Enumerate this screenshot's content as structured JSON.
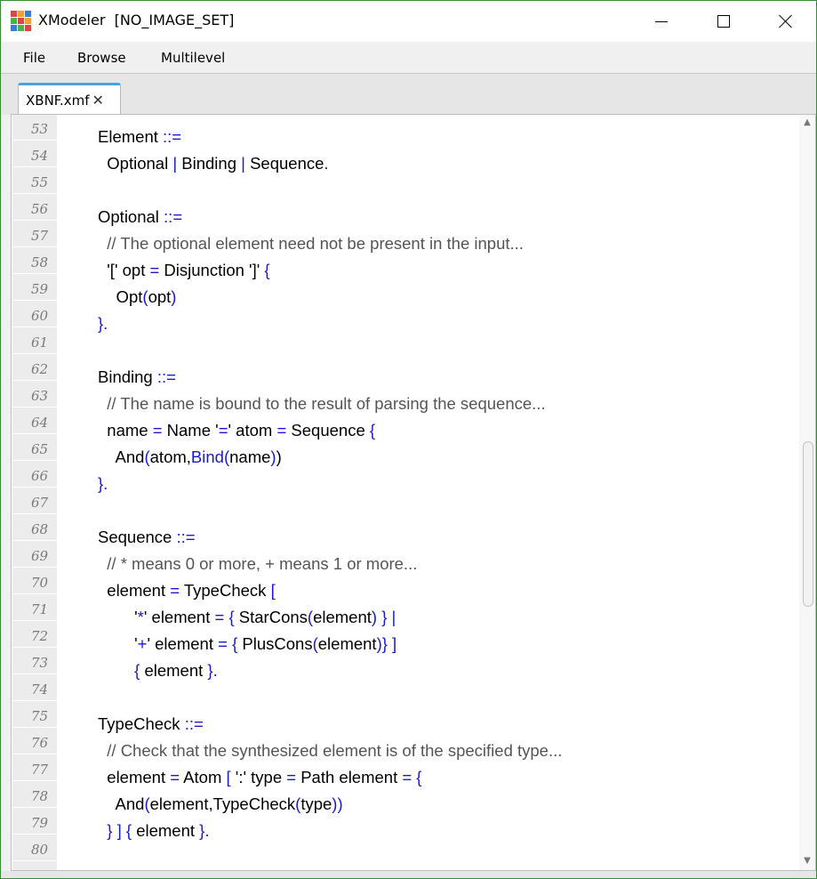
{
  "window": {
    "title": "XModeler  [NO_IMAGE_SET]",
    "icon_name": "xmodeler-app-icon",
    "icon_colors": [
      "#e04343",
      "#f2a12a",
      "#3a7bd5",
      "#4caf50",
      "#e04343",
      "#f2a12a",
      "#3a7bd5",
      "#4caf50",
      "#e04343"
    ],
    "buttons": {
      "minimize": "minimize-icon",
      "maximize": "maximize-icon",
      "close": "close-icon"
    }
  },
  "menu": {
    "items": [
      "File",
      "Browse",
      "Multilevel"
    ]
  },
  "tabs": [
    {
      "label": "XBNF.xmf",
      "close": "✕",
      "active": true
    }
  ],
  "editor": {
    "lines": [
      {
        "n": "53",
        "parts": [
          [
            "",
            "Element "
          ],
          [
            "kw",
            "::="
          ]
        ]
      },
      {
        "n": "54",
        "parts": [
          [
            "",
            "  Optional "
          ],
          [
            "kw",
            "|"
          ],
          [
            "",
            " Binding "
          ],
          [
            "kw",
            "|"
          ],
          [
            "",
            " Sequence"
          ],
          [
            "kw",
            "."
          ]
        ]
      },
      {
        "n": "55",
        "parts": []
      },
      {
        "n": "56",
        "parts": [
          [
            "",
            "Optional "
          ],
          [
            "kw",
            "::="
          ]
        ]
      },
      {
        "n": "57",
        "parts": [
          [
            "cm",
            "  // The optional element need not be present in the input..."
          ]
        ]
      },
      {
        "n": "58",
        "parts": [
          [
            "",
            "  '[' opt "
          ],
          [
            "kw",
            "="
          ],
          [
            "",
            " Disjunction ']' "
          ],
          [
            "kw",
            "{"
          ]
        ]
      },
      {
        "n": "59",
        "parts": [
          [
            "",
            "    Opt"
          ],
          [
            "kw",
            "("
          ],
          [
            "",
            "opt"
          ],
          [
            "kw",
            ")"
          ]
        ]
      },
      {
        "n": "60",
        "parts": [
          [
            "kw",
            "}."
          ]
        ]
      },
      {
        "n": "61",
        "parts": []
      },
      {
        "n": "62",
        "parts": [
          [
            "",
            "Binding "
          ],
          [
            "kw",
            "::="
          ]
        ]
      },
      {
        "n": "63",
        "parts": [
          [
            "cm",
            "  // The name is bound to the result of parsing the sequence..."
          ]
        ]
      },
      {
        "n": "64",
        "parts": [
          [
            "",
            "  name "
          ],
          [
            "kw",
            "="
          ],
          [
            "",
            " Name '"
          ],
          [
            "kw",
            "="
          ],
          [
            "",
            "' atom "
          ],
          [
            "kw",
            "="
          ],
          [
            "",
            " Sequence "
          ],
          [
            "kw",
            "{"
          ]
        ]
      },
      {
        "n": "65",
        "parts": [
          [
            "",
            "    And"
          ],
          [
            "kw",
            "("
          ],
          [
            "",
            "atom,"
          ],
          [
            "kw",
            "Bind("
          ],
          [
            "",
            "name"
          ],
          [
            "kw",
            ")"
          ],
          [
            "",
            ")"
          ]
        ]
      },
      {
        "n": "66",
        "parts": [
          [
            "kw",
            "}."
          ]
        ]
      },
      {
        "n": "67",
        "parts": []
      },
      {
        "n": "68",
        "parts": [
          [
            "",
            "Sequence "
          ],
          [
            "kw",
            "::="
          ]
        ]
      },
      {
        "n": "69",
        "parts": [
          [
            "cm",
            "  // * means 0 or more, + means 1 or more..."
          ]
        ]
      },
      {
        "n": "70",
        "parts": [
          [
            "",
            "  element "
          ],
          [
            "kw",
            "="
          ],
          [
            "",
            " TypeCheck "
          ],
          [
            "kw",
            "["
          ]
        ]
      },
      {
        "n": "71",
        "parts": [
          [
            "",
            "        '"
          ],
          [
            "kw",
            "*"
          ],
          [
            "",
            "' element "
          ],
          [
            "kw",
            "="
          ],
          [
            "",
            " "
          ],
          [
            "kw",
            "{"
          ],
          [
            "",
            " StarCons"
          ],
          [
            "kw",
            "("
          ],
          [
            "",
            "element"
          ],
          [
            "kw",
            ")"
          ],
          [
            "",
            " "
          ],
          [
            "kw",
            "} |"
          ]
        ]
      },
      {
        "n": "72",
        "parts": [
          [
            "",
            "        '"
          ],
          [
            "kw",
            "+"
          ],
          [
            "",
            "' element "
          ],
          [
            "kw",
            "="
          ],
          [
            "",
            " "
          ],
          [
            "kw",
            "{"
          ],
          [
            "",
            " PlusCons"
          ],
          [
            "kw",
            "("
          ],
          [
            "",
            "element"
          ],
          [
            "kw",
            ")} ]"
          ]
        ]
      },
      {
        "n": "73",
        "parts": [
          [
            "kw",
            "        {"
          ],
          [
            "",
            " element "
          ],
          [
            "kw",
            "}."
          ]
        ]
      },
      {
        "n": "74",
        "parts": []
      },
      {
        "n": "75",
        "parts": [
          [
            "",
            "TypeCheck "
          ],
          [
            "kw",
            "::="
          ]
        ]
      },
      {
        "n": "76",
        "parts": [
          [
            "cm",
            "  // Check that the synthesized element is of the specified type..."
          ]
        ]
      },
      {
        "n": "77",
        "parts": [
          [
            "",
            "  element "
          ],
          [
            "kw",
            "="
          ],
          [
            "",
            " Atom "
          ],
          [
            "kw",
            "["
          ],
          [
            "",
            " ':' type "
          ],
          [
            "kw",
            "="
          ],
          [
            "",
            " Path element "
          ],
          [
            "kw",
            "= {"
          ]
        ]
      },
      {
        "n": "78",
        "parts": [
          [
            "",
            "    And"
          ],
          [
            "kw",
            "("
          ],
          [
            "",
            "element,TypeCheck"
          ],
          [
            "kw",
            "("
          ],
          [
            "",
            "type"
          ],
          [
            "kw",
            "))"
          ]
        ]
      },
      {
        "n": "79",
        "parts": [
          [
            "kw",
            "  } ] {"
          ],
          [
            "",
            " element "
          ],
          [
            "kw",
            "}."
          ]
        ]
      },
      {
        "n": "80",
        "parts": []
      }
    ]
  },
  "scrollbar": {
    "up": "▲",
    "down": "▼"
  }
}
